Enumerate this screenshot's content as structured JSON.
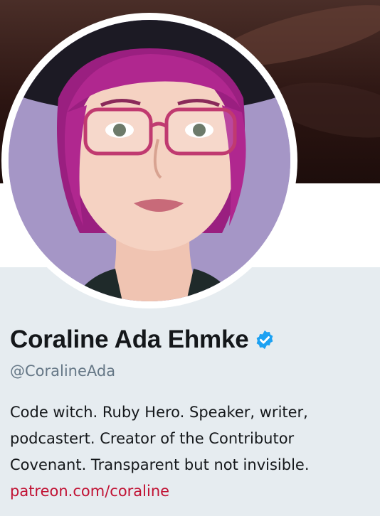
{
  "profile": {
    "display_name": "Coraline Ada Ehmke",
    "handle": "@CoralineAda",
    "verified_icon": "verified-badge-icon",
    "bio_lines": [
      "Code witch. Ruby Hero. Speaker, writer,",
      "podcastert. Creator of the Contributor",
      "Covenant. Transparent but not invisible."
    ],
    "website": "patreon.com/coraline"
  },
  "colors": {
    "name": "#14171a",
    "handle": "#657786",
    "link": "#c11133",
    "verified": "#1da1f2",
    "panel_bg": "#e6ecf0",
    "avatar_bg": "#a596c6",
    "hair": "#b0278f"
  }
}
